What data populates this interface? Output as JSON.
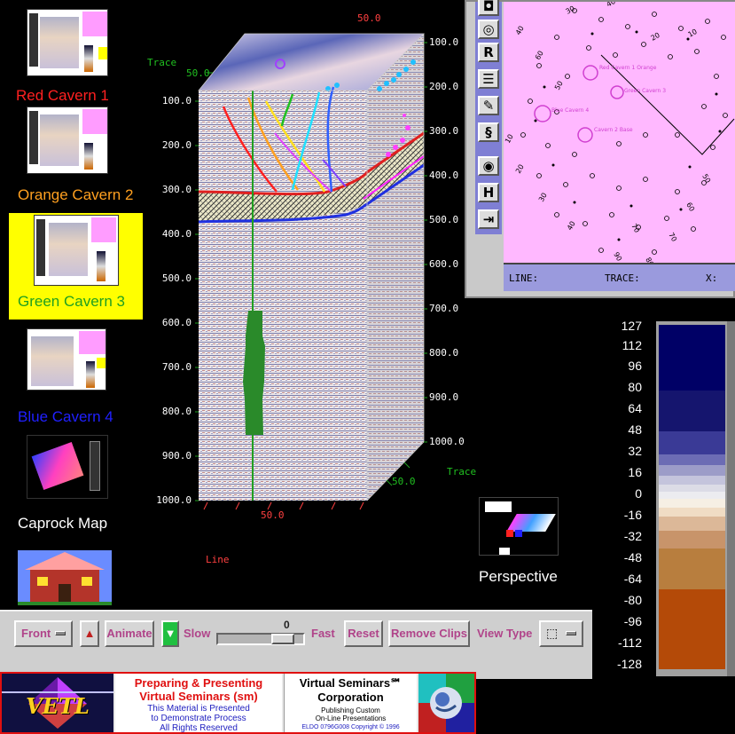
{
  "navigation": {
    "items": [
      {
        "label": "Red Cavern 1",
        "color": "#ff2020"
      },
      {
        "label": "Orange Cavern 2",
        "color": "#ffa020"
      },
      {
        "label": "Green Cavern 3",
        "color": "#20a020",
        "selected": true
      },
      {
        "label": "Blue Cavern 4",
        "color": "#2020ff"
      },
      {
        "label": "Caprock Map",
        "color": "#ffffff"
      }
    ],
    "perspective_label": "Perspective"
  },
  "scene": {
    "trace_label_top": "Trace",
    "trace_label_bottom": "Trace",
    "line_label": "Line",
    "left_depth_ticks": [
      "100.0",
      "200.0",
      "300.0",
      "400.0",
      "500.0",
      "600.0",
      "700.0",
      "800.0",
      "900.0",
      "1000.0"
    ],
    "right_depth_ticks": [
      "100.0",
      "200.0",
      "300.0",
      "400.0",
      "500.0",
      "600.0",
      "700.0",
      "800.0",
      "900.0",
      "1000.0"
    ],
    "top_tick_trace": "50.0",
    "top_tick_line": "50.0",
    "bottom_tick_line": "50.0",
    "bottom_tick_trace": "50.0"
  },
  "map_window": {
    "tools": [
      "zoom",
      "pan",
      "R",
      "list",
      "edit",
      "notes",
      "rotate",
      "H",
      "exit"
    ],
    "status_line_label": "LINE:",
    "status_trace_label": "TRACE:",
    "status_x_label": "X:",
    "cavern_labels": [
      "Red Cavern 1 Orange",
      "Green Cavern 3",
      "Blue Cavern 4",
      "Cavern 2 Base"
    ]
  },
  "colorbar": {
    "ticks": [
      "127",
      "112",
      "96",
      "80",
      "64",
      "48",
      "32",
      "16",
      "0",
      "-16",
      "-32",
      "-48",
      "-64",
      "-80",
      "-96",
      "-112",
      "-128"
    ]
  },
  "controls": {
    "view_select": "Front",
    "animate_label": "Animate",
    "slow_label": "Slow",
    "fast_label": "Fast",
    "speed_value": "0",
    "speed_fraction": 0.9,
    "reset_label": "Reset",
    "remove_clips_label": "Remove Clips",
    "view_type_label": "View Type"
  },
  "banner": {
    "logo_text": "VETL",
    "title_line1": "Preparing & Presenting",
    "title_line2": "Virtual Seminars (sm)",
    "sub_line1": "This Material is Presented",
    "sub_line2": "to Demonstrate Process",
    "sub_line3": "All Rights Reserved",
    "company_line1": "Virtual Seminars℠",
    "company_line2": "Corporation",
    "company_sub1": "Publishing Custom",
    "company_sub2": "On-Line Presentations",
    "copyright": "ELDO 0796G008 Copyright © 1996"
  }
}
